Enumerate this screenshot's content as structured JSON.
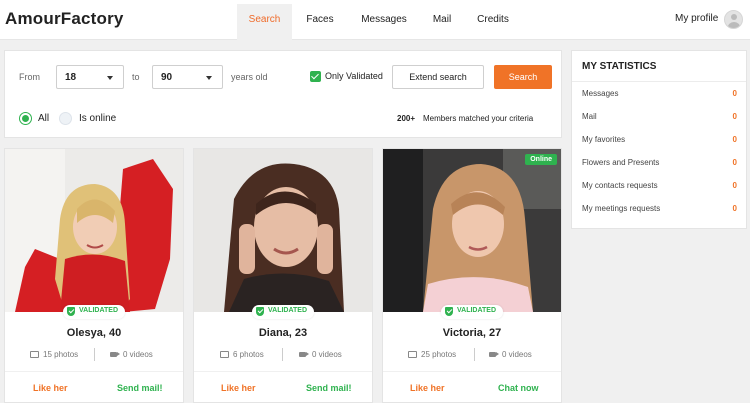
{
  "header": {
    "logo": "AmourFactory",
    "nav": [
      {
        "label": "Search",
        "active": true
      },
      {
        "label": "Faces"
      },
      {
        "label": "Messages"
      },
      {
        "label": "Mail"
      },
      {
        "label": "Credits"
      }
    ],
    "profile_label": "My profile"
  },
  "filter": {
    "from_label": "From",
    "from_value": "18",
    "to_label": "to",
    "to_value": "90",
    "years_label": "years old",
    "only_validated_label": "Only Validated",
    "only_validated_checked": true,
    "extend_search_label": "Extend search",
    "search_label": "Search",
    "radio_all_label": "All",
    "radio_online_label": "Is online",
    "radio_selected": "All",
    "matched_count": "200+",
    "matched_text": "Members matched your criteria"
  },
  "stats": {
    "title": "MY STATISTICS",
    "rows": [
      {
        "label": "Messages",
        "value": "0"
      },
      {
        "label": "Mail",
        "value": "0"
      },
      {
        "label": "My favorites",
        "value": "0"
      },
      {
        "label": "Flowers and Presents",
        "value": "0"
      },
      {
        "label": "My contacts requests",
        "value": "0"
      },
      {
        "label": "My meetings requests",
        "value": "0"
      }
    ]
  },
  "cards": [
    {
      "validated": "VALIDATED",
      "name": "Olesya, 40",
      "photos": "15 photos",
      "videos": "0 videos",
      "like": "Like her",
      "action": "Send mail!",
      "online": false
    },
    {
      "validated": "VALIDATED",
      "name": "Diana, 23",
      "photos": "6 photos",
      "videos": "0 videos",
      "like": "Like her",
      "action": "Send mail!",
      "online": false
    },
    {
      "validated": "VALIDATED",
      "name": "Victoria, 27",
      "photos": "25 photos",
      "videos": "0 videos",
      "like": "Like her",
      "action": "Chat now",
      "online": true,
      "online_label": "Online"
    }
  ],
  "colors": {
    "accent": "#f07327",
    "green": "#2fb24f"
  }
}
